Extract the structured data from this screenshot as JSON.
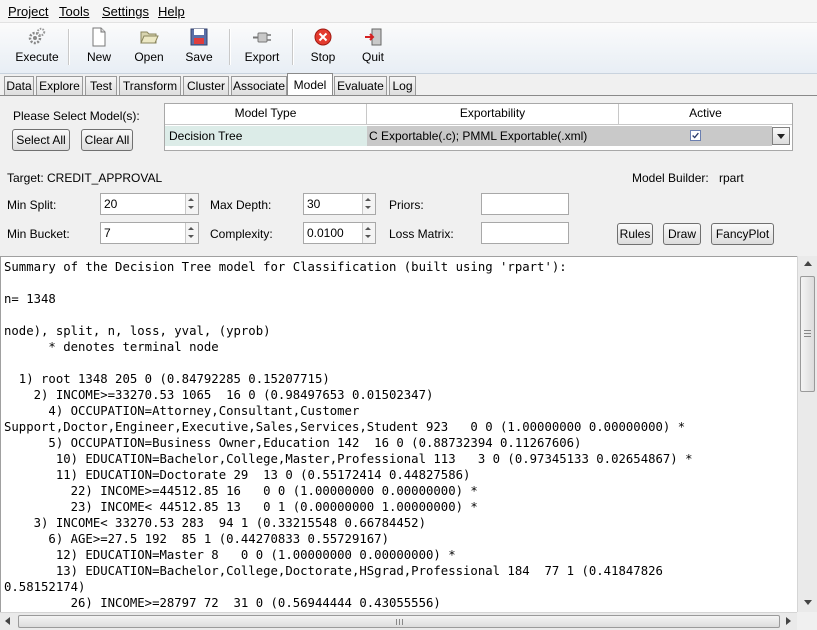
{
  "menu": {
    "items": [
      {
        "label": "Project",
        "accel": "P"
      },
      {
        "label": "Tools",
        "accel": "T"
      },
      {
        "label": "Settings",
        "accel": "S"
      },
      {
        "label": "Help",
        "accel": "H"
      }
    ]
  },
  "toolbar": {
    "execute": "Execute",
    "new": "New",
    "open": "Open",
    "save": "Save",
    "export": "Export",
    "stop": "Stop",
    "quit": "Quit"
  },
  "tabs": [
    "Data",
    "Explore",
    "Test",
    "Transform",
    "Cluster",
    "Associate",
    "Model",
    "Evaluate",
    "Log"
  ],
  "active_tab": "Model",
  "model_panel": {
    "select_label": "Please Select Model(s):",
    "select_all": "Select All",
    "clear_all": "Clear All",
    "table": {
      "headers": [
        "Model Type",
        "Exportability",
        "Active"
      ],
      "row": {
        "model_type": "Decision Tree",
        "exportability": "C Exportable(.c); PMML Exportable(.xml)",
        "active_checked": true
      }
    },
    "target": "Target: CREDIT_APPROVAL",
    "model_builder_label": "Model Builder:",
    "model_builder_value": "rpart",
    "min_split_label": "Min Split:",
    "min_split": "20",
    "max_depth_label": "Max Depth:",
    "max_depth": "30",
    "priors_label": "Priors:",
    "priors": "",
    "min_bucket_label": "Min Bucket:",
    "min_bucket": "7",
    "complexity_label": "Complexity:",
    "complexity": "0.0100",
    "loss_matrix_label": "Loss Matrix:",
    "loss_matrix": "",
    "rules_button": "Rules",
    "draw_button": "Draw",
    "fancyplot_button": "FancyPlot"
  },
  "output_text": "Summary of the Decision Tree model for Classification (built using 'rpart'):\n\nn= 1348\n\nnode), split, n, loss, yval, (yprob)\n      * denotes terminal node\n\n  1) root 1348 205 0 (0.84792285 0.15207715)\n    2) INCOME>=33270.53 1065  16 0 (0.98497653 0.01502347)\n      4) OCCUPATION=Attorney,Consultant,Customer\nSupport,Doctor,Engineer,Executive,Sales,Services,Student 923   0 0 (1.00000000 0.00000000) *\n      5) OCCUPATION=Business Owner,Education 142  16 0 (0.88732394 0.11267606)\n       10) EDUCATION=Bachelor,College,Master,Professional 113   3 0 (0.97345133 0.02654867) *\n       11) EDUCATION=Doctorate 29  13 0 (0.55172414 0.44827586)\n         22) INCOME>=44512.85 16   0 0 (1.00000000 0.00000000) *\n         23) INCOME< 44512.85 13   0 1 (0.00000000 1.00000000) *\n    3) INCOME< 33270.53 283  94 1 (0.33215548 0.66784452)\n      6) AGE>=27.5 192  85 1 (0.44270833 0.55729167)\n       12) EDUCATION=Master 8   0 0 (1.00000000 0.00000000) *\n       13) EDUCATION=Bachelor,College,Doctorate,HSgrad,Professional 184  77 1 (0.41847826\n0.58152174)\n         26) INCOME>=28797 72  31 0 (0.56944444 0.43055556)"
}
